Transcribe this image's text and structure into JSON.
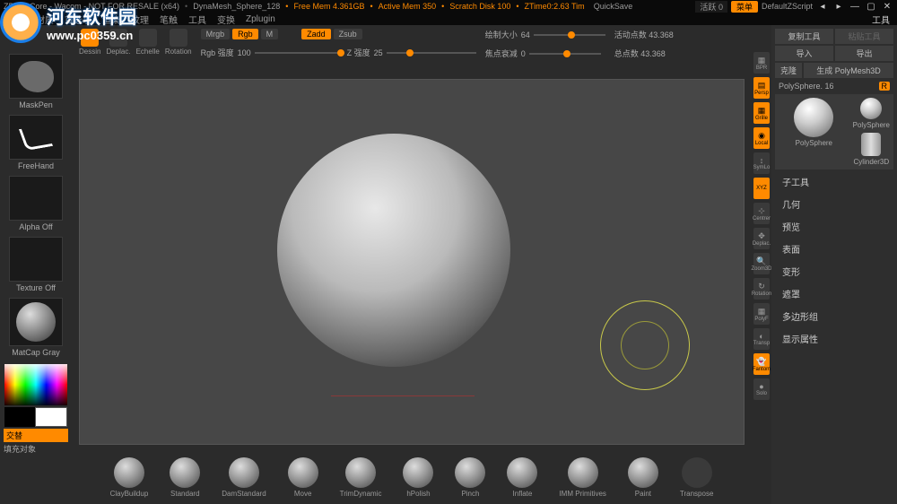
{
  "title": {
    "app": "ZBrushCore - Wacom - NOT FOR RESALE (x64)",
    "doc": "DynaMesh_Sphere_128",
    "mem": "Free Mem 4.361GB",
    "active": "Active Mem 350",
    "scratch": "Scratch Disk 100",
    "ztime": "ZTime0:2.63 Tim",
    "quicksave": "QuickSave",
    "menu": "菜单",
    "script": "DefaultZScript",
    "actval": "0"
  },
  "menubar": [
    "灯光",
    "材质",
    "首选项",
    "渲染",
    "纹理",
    "笔触",
    "工具",
    "变换",
    "Zplugin"
  ],
  "watermark": {
    "text": "河东软件园",
    "url": "www.pc0359.cn"
  },
  "topctrl": {
    "tools": [
      {
        "label": "Dessin"
      },
      {
        "label": "Deplac."
      },
      {
        "label": "Echelle"
      },
      {
        "label": "Rotation"
      }
    ],
    "modes": {
      "mrgb": "Mrgb",
      "rgb": "Rgb",
      "m": "M",
      "zadd": "Zadd",
      "zsub": "Zsub"
    },
    "sliders": {
      "rgb_label": "Rgb 强度",
      "rgb_val": "100",
      "z_label": "Z 强度",
      "z_val": "25",
      "draw_label": "绘制大小",
      "draw_val": "64",
      "focal_label": "焦点衰减",
      "focal_val": "0",
      "active_label": "活动点数",
      "active_val": "43.368",
      "total_label": "总点数",
      "total_val": "43.368"
    }
  },
  "left": {
    "maskpen": "MaskPen",
    "freehand": "FreeHand",
    "alphaoff": "Alpha Off",
    "textureoff": "Texture Off",
    "matcap": "MatCap Gray",
    "fill": "交替",
    "filllabel": "填充对象"
  },
  "rail": [
    "BPR",
    "Persp",
    "Grille",
    "Local",
    "SymLo",
    "XYZ",
    "Centrer",
    "Deplac.",
    "Zoom3D",
    "Rotation",
    "PolyF",
    "Transp",
    "Fantom",
    "Solo"
  ],
  "rightpanel": {
    "title": "工具",
    "copy": "复制工具",
    "paste": "粘贴工具",
    "import": "导入",
    "export": "导出",
    "clone": "克隆",
    "polymesh": "生成 PolyMesh3D",
    "name": "PolySphere. 16",
    "r": "R",
    "tools": [
      {
        "name": "PolySphere"
      },
      {
        "name": "PolySphere"
      },
      {
        "name": "Cylinder3D"
      }
    ],
    "sections": [
      "子工具",
      "几何",
      "预览",
      "表面",
      "变形",
      "遮罩",
      "多边形组",
      "显示属性"
    ]
  },
  "brushes": [
    "ClayBuildup",
    "Standard",
    "DamStandard",
    "Move",
    "TrimDynamic",
    "hPolish",
    "Pinch",
    "Inflate",
    "IMM Primitives",
    "Paint",
    "Transpose"
  ]
}
